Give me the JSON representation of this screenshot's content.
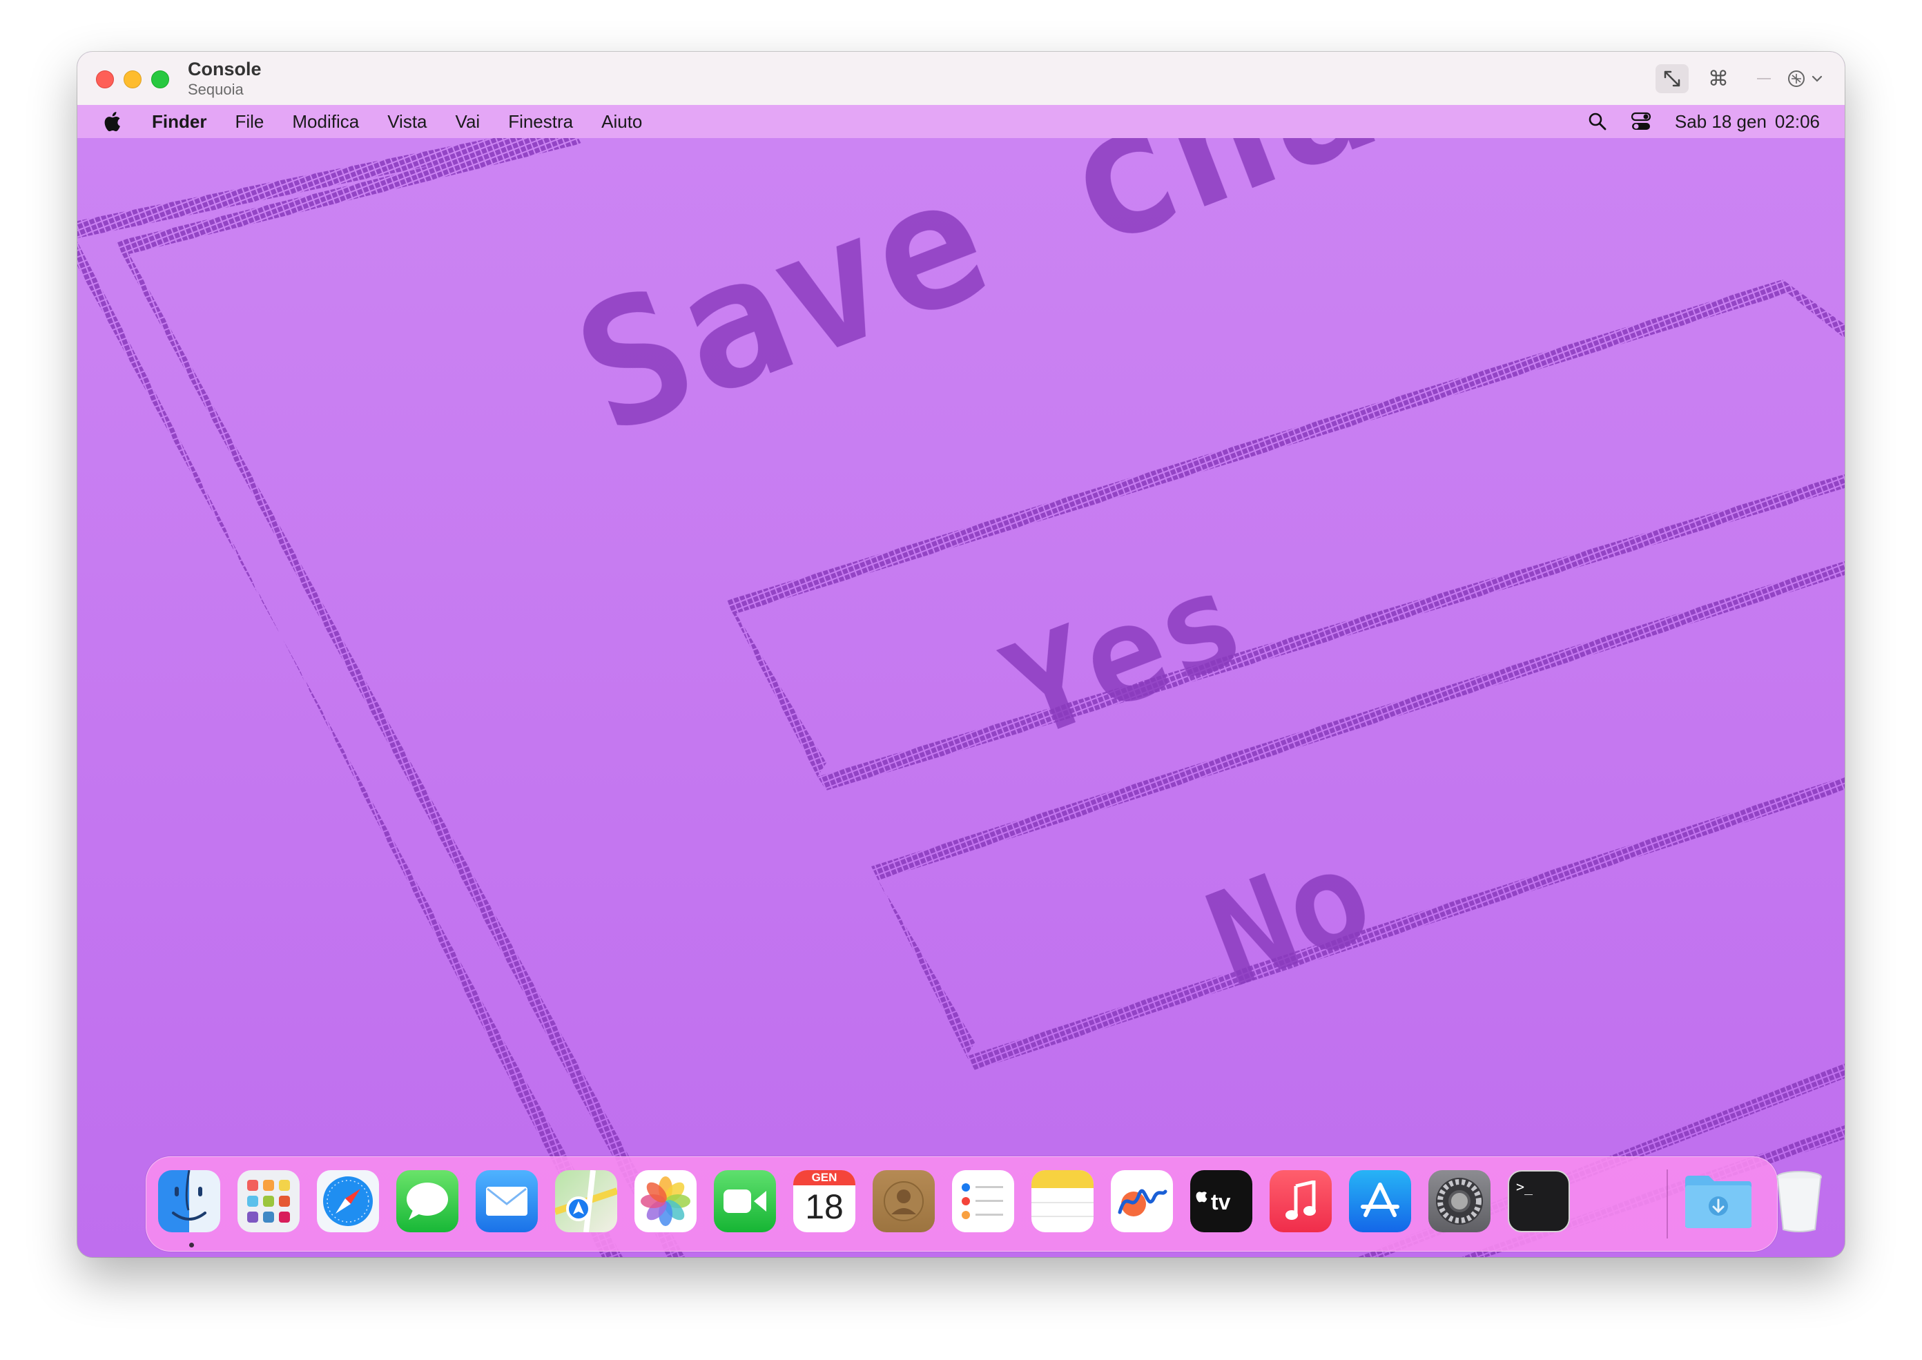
{
  "window": {
    "title": "Console",
    "subtitle": "Sequoia"
  },
  "titlebar_icons": [
    "resize-icon",
    "command-icon",
    "minus-icon",
    "screen-share-menu-icon"
  ],
  "menubar": {
    "apple_icon": "apple-logo-icon",
    "items": [
      "Finder",
      "File",
      "Modifica",
      "Vista",
      "Vai",
      "Finestra",
      "Aiuto"
    ],
    "right_icons": [
      "search-icon",
      "control-center-icon"
    ],
    "date": "Sab 18 gen",
    "time": "02:06"
  },
  "wallpaper": {
    "title_text": "Save chang",
    "yes_label": "Yes",
    "no_label": "No",
    "background_color": "#c77ef2",
    "pixel_color": "#8a3bbd"
  },
  "dock": {
    "calendar_month": "GEN",
    "calendar_day": "18",
    "apps": [
      "Finder",
      "Launchpad",
      "Safari",
      "Messaggi",
      "Mail",
      "Mappe",
      "Foto",
      "FaceTime",
      "Calendario",
      "Contatti",
      "Promemoria",
      "Note",
      "Freeform",
      "TV",
      "Musica",
      "App Store",
      "Impostazioni di Sistema",
      "Terminale",
      "Download",
      "Cestino"
    ]
  }
}
